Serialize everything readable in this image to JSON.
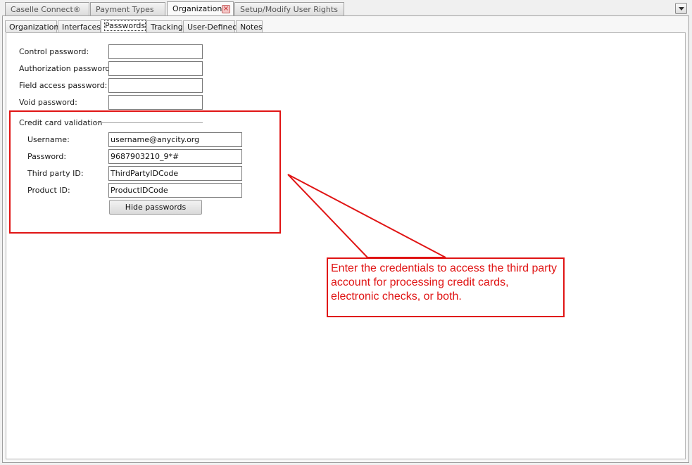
{
  "doc_tabs": [
    {
      "label": "Caselle Connect®"
    },
    {
      "label": "Payment Types"
    },
    {
      "label": "Organization",
      "active": true
    },
    {
      "label": "Setup/Modify User Rights"
    }
  ],
  "sub_tabs": [
    {
      "label": "Organization"
    },
    {
      "label": "Interfaces"
    },
    {
      "label": "Passwords",
      "active": true
    },
    {
      "label": "Tracking"
    },
    {
      "label": "User-Defined"
    },
    {
      "label": "Notes"
    }
  ],
  "passwords": {
    "control_label": "Control password:",
    "control_value": "",
    "authorization_label": "Authorization password:",
    "authorization_value": "",
    "field_access_label": "Field access password:",
    "field_access_value": "",
    "void_label": "Void password:",
    "void_value": ""
  },
  "credit_card": {
    "group_title": "Credit card validation",
    "username_label": "Username:",
    "username_value": "username@anycity.org",
    "password_label": "Password:",
    "password_value": "9687903210_9*#",
    "third_party_label": "Third party ID:",
    "third_party_value": "ThirdPartyIDCode",
    "product_label": "Product ID:",
    "product_value": "ProductIDCode",
    "hide_button": "Hide passwords"
  },
  "callout": {
    "text": "Enter the credentials to access the third party account for processing credit cards, electronic checks, or both.",
    "color": "#e01414"
  },
  "icons": {
    "tab_close": "close-icon",
    "tab_menu": "chevron-down-icon"
  }
}
